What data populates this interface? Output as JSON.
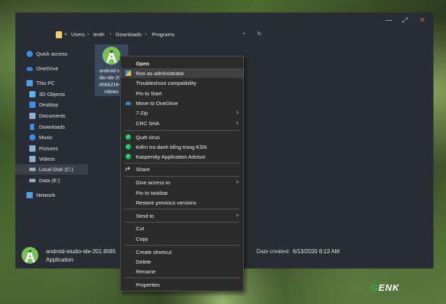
{
  "window": {
    "controls": {
      "minimize": "—",
      "maximize": "⤢",
      "close": "✕"
    }
  },
  "address": {
    "overflow": "«",
    "crumbs": [
      "Users",
      "lexth",
      "Downloads",
      "Programs"
    ],
    "separator": "›",
    "dropdown": "⌄",
    "refresh": "↻"
  },
  "nav": {
    "items": [
      {
        "label": "Quick access",
        "icon": "star-icon",
        "color": "#3a8ee6"
      },
      {
        "label": "OneDrive",
        "icon": "cloud-icon",
        "color": "#2f86d8"
      },
      {
        "label": "This PC",
        "icon": "computer-icon",
        "color": "#4aa3df"
      },
      {
        "label": "3D Objects",
        "icon": "cube-icon",
        "color": "#5bb4e8"
      },
      {
        "label": "Desktop",
        "icon": "desktop-icon",
        "color": "#3a8ee6"
      },
      {
        "label": "Documents",
        "icon": "document-icon",
        "color": "#8fb0d0"
      },
      {
        "label": "Downloads",
        "icon": "download-icon",
        "color": "#3a8ee6"
      },
      {
        "label": "Music",
        "icon": "music-icon",
        "color": "#3a8ee6"
      },
      {
        "label": "Pictures",
        "icon": "pictures-icon",
        "color": "#8fb0d0"
      },
      {
        "label": "Videos",
        "icon": "video-icon",
        "color": "#8fb0d0"
      },
      {
        "label": "Local Disk (C:)",
        "icon": "disk-icon",
        "color": "#9aa8b8"
      },
      {
        "label": "Data (E:)",
        "icon": "disk-icon",
        "color": "#9aa8b8"
      },
      {
        "label": "Network",
        "icon": "network-icon",
        "color": "#4aa3df"
      }
    ]
  },
  "file": {
    "name": "android-studio-ide-201.6565218-windows",
    "name_lines": [
      "android-stu",
      "dio-ide-201",
      ".6565218-wi",
      "ndows"
    ]
  },
  "details": {
    "name": "android-studio-ide-201.6565",
    "type": "Application",
    "date_label": "Date created:",
    "date_value": "6/13/2020 8:13 AM"
  },
  "menu": {
    "items": [
      {
        "label": "Open",
        "bold": true
      },
      {
        "label": "Run as administrator",
        "icon": "shield-icon",
        "highlight": true
      },
      {
        "label": "Troubleshoot compatibility"
      },
      {
        "label": "Pin to Start"
      },
      {
        "label": "Move to OneDrive",
        "icon": "cloud-icon"
      },
      {
        "label": "7-Zip",
        "submenu": true
      },
      {
        "label": "CRC SHA",
        "submenu": true
      },
      {
        "label": "Quét virus",
        "icon": "kaspersky-check-icon"
      },
      {
        "label": "Kiểm tra danh tiếng trong KSN",
        "icon": "kaspersky-check-icon"
      },
      {
        "label": "Kaspersky Application Advisor",
        "icon": "kaspersky-check-icon"
      },
      {
        "label": "Share",
        "icon": "share-icon"
      },
      {
        "label": "Give access to",
        "submenu": true
      },
      {
        "label": "Pin to taskbar"
      },
      {
        "label": "Restore previous versions"
      },
      {
        "label": "Send to",
        "submenu": true
      },
      {
        "label": "Cut"
      },
      {
        "label": "Copy"
      },
      {
        "label": "Create shortcut"
      },
      {
        "label": "Delete"
      },
      {
        "label": "Rename"
      },
      {
        "label": "Properties"
      }
    ],
    "submenu_arrow": "›"
  },
  "watermark": {
    "g": "G",
    "rest": "ENK"
  }
}
